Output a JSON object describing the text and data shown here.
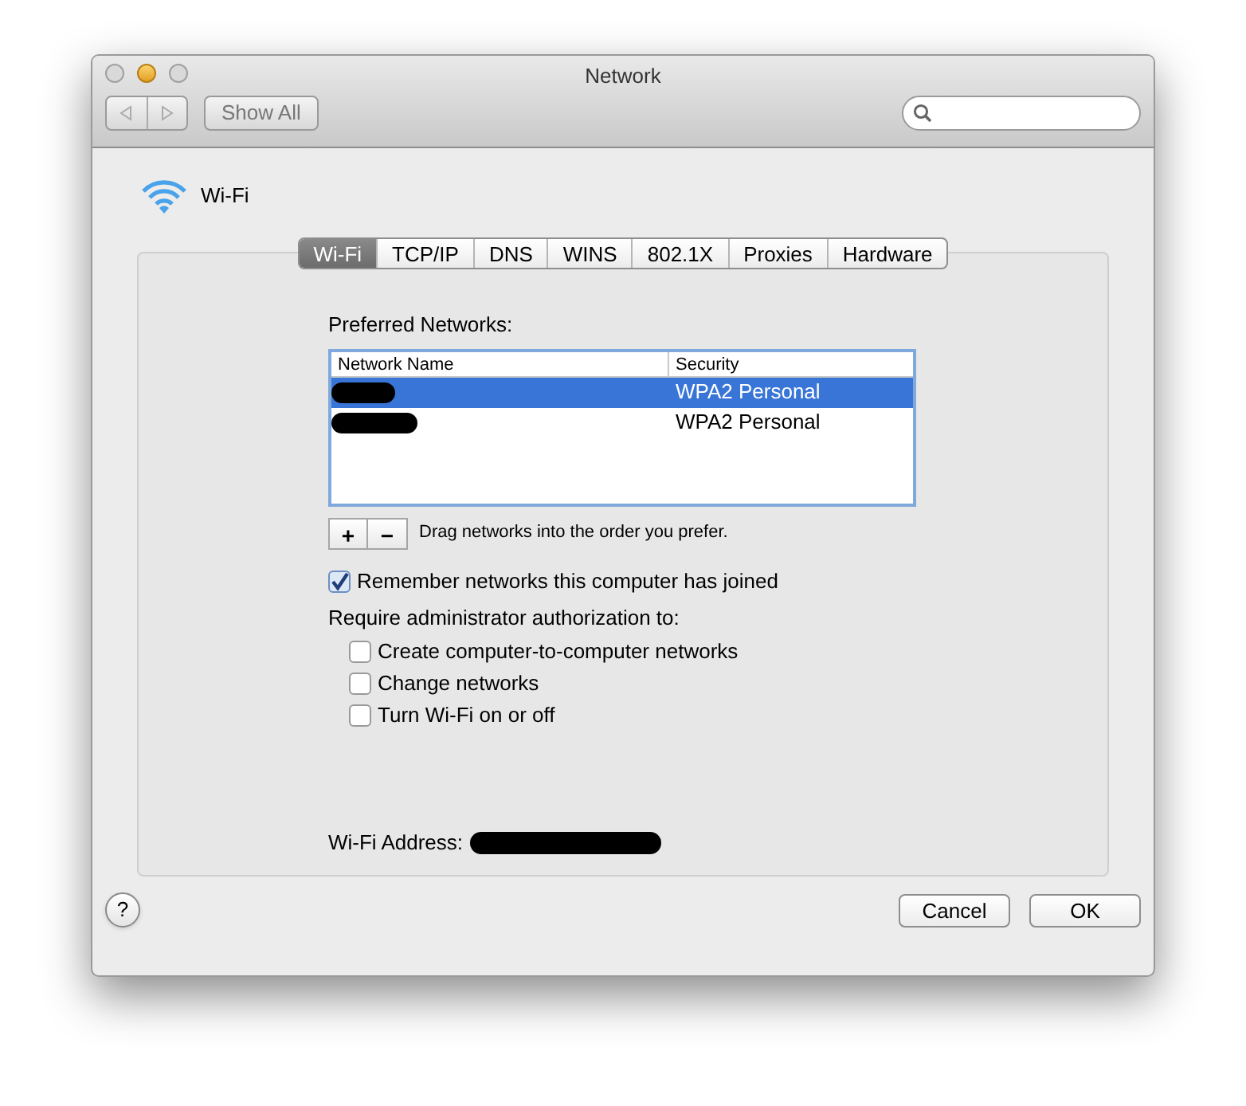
{
  "window": {
    "title": "Network"
  },
  "toolbar": {
    "show_all": "Show All"
  },
  "service": {
    "name": "Wi-Fi"
  },
  "tabs": [
    {
      "label": "Wi-Fi",
      "selected": true
    },
    {
      "label": "TCP/IP",
      "selected": false
    },
    {
      "label": "DNS",
      "selected": false
    },
    {
      "label": "WINS",
      "selected": false
    },
    {
      "label": "802.1X",
      "selected": false
    },
    {
      "label": "Proxies",
      "selected": false
    },
    {
      "label": "Hardware",
      "selected": false
    }
  ],
  "preferred_networks": {
    "label": "Preferred Networks:",
    "columns": [
      "Network Name",
      "Security"
    ],
    "rows": [
      {
        "security": "WPA2 Personal",
        "selected": true
      },
      {
        "security": "WPA2 Personal",
        "selected": false
      }
    ],
    "add": "+",
    "remove": "−",
    "hint": "Drag networks into the order you prefer."
  },
  "remember": {
    "label": "Remember networks this computer has joined",
    "checked": true
  },
  "require_label": "Require administrator authorization to:",
  "options": [
    {
      "label": "Create computer-to-computer networks",
      "checked": false
    },
    {
      "label": "Change networks",
      "checked": false
    },
    {
      "label": "Turn Wi-Fi on or off",
      "checked": false
    }
  ],
  "address": {
    "label": "Wi-Fi Address:"
  },
  "help": "?",
  "buttons": {
    "cancel": "Cancel",
    "ok": "OK"
  }
}
